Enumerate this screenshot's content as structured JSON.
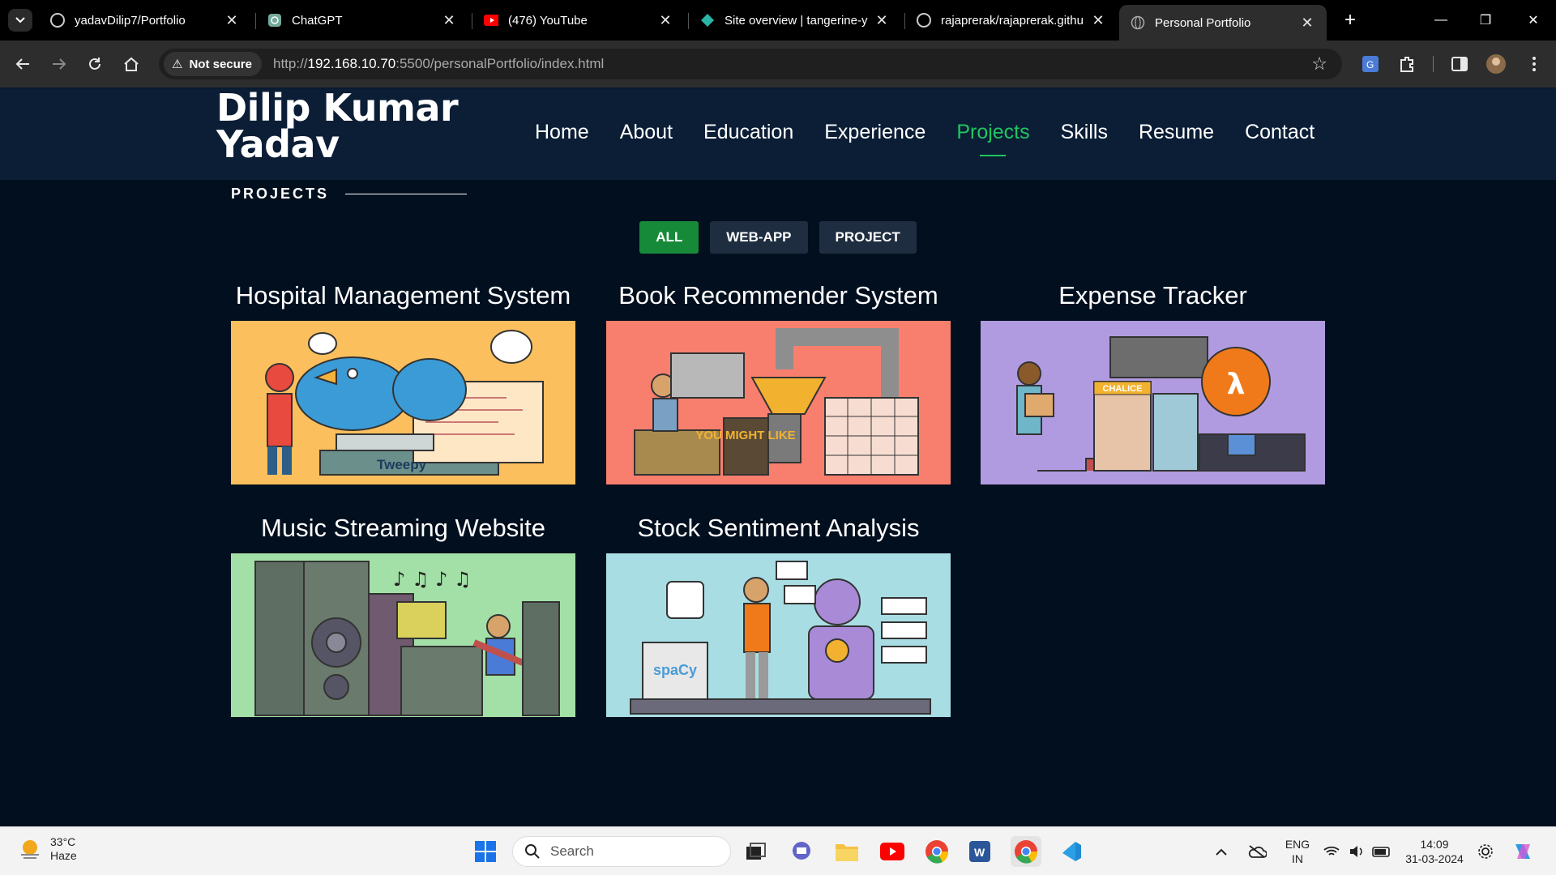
{
  "browser": {
    "tabs": [
      {
        "title": "yadavDilip7/Portfolio",
        "icon": "github-icon"
      },
      {
        "title": "ChatGPT",
        "icon": "chatgpt-icon"
      },
      {
        "title": "(476) YouTube",
        "icon": "youtube-icon"
      },
      {
        "title": "Site overview | tangerine-y",
        "icon": "netlify-icon"
      },
      {
        "title": "rajaprerak/rajaprerak.githu",
        "icon": "github-icon"
      },
      {
        "title": "Personal Portfolio",
        "icon": "globe-icon"
      }
    ],
    "security_label": "Not secure",
    "url_prefix": "http://",
    "url_host": "192.168.10.70",
    "url_rest": ":5500/personalPortfolio/index.html"
  },
  "site": {
    "brand_line1": "Dilip Kumar",
    "brand_line2": "Yadav",
    "nav": [
      "Home",
      "About",
      "Education",
      "Experience",
      "Projects",
      "Skills",
      "Resume",
      "Contact"
    ],
    "active_nav": "Projects",
    "accent_color": "#22c55e"
  },
  "projects": {
    "section_title": "PROJECTS",
    "filters": [
      "ALL",
      "WEB-APP",
      "PROJECT"
    ],
    "active_filter": "ALL",
    "cards": [
      {
        "title": "Hospital Management System",
        "bg": "#fbbf5d",
        "art_label": "Tweepy"
      },
      {
        "title": "Book Recommender System",
        "bg": "#f87f6e",
        "art_label": "YOU MIGHT LIKE"
      },
      {
        "title": "Expense Tracker",
        "bg": "#b19be0",
        "art_label": "CHALICE"
      },
      {
        "title": "Music Streaming Website",
        "bg": "#a3e0a7",
        "art_label": ""
      },
      {
        "title": "Stock Sentiment Analysis",
        "bg": "#a9dde4",
        "art_label": "spaCy"
      }
    ]
  },
  "taskbar": {
    "temperature": "33°C",
    "condition": "Haze",
    "search_placeholder": "Search",
    "lang_top": "ENG",
    "lang_bottom": "IN",
    "time": "14:09",
    "date": "31-03-2024"
  }
}
